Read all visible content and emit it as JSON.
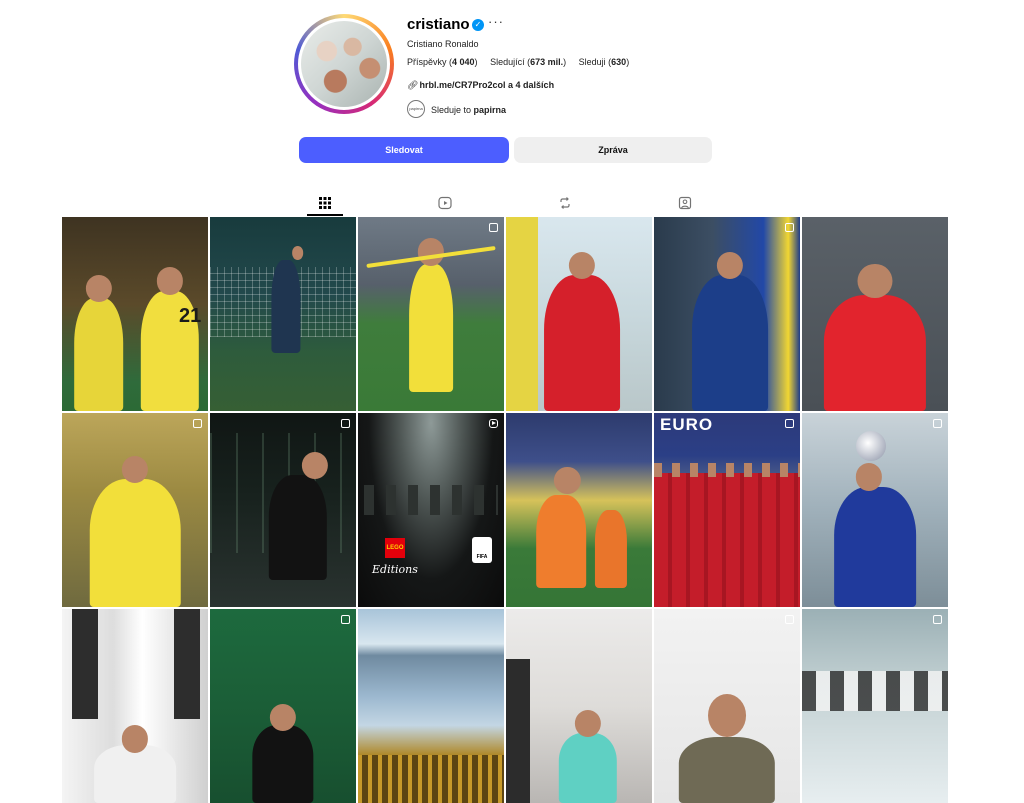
{
  "profile": {
    "username": "cristiano",
    "full_name": "Cristiano Ronaldo",
    "stats": {
      "posts_label": "Příspěvky",
      "posts_value": "4 040",
      "followers_label": "Sledující",
      "followers_value": "673 mil.",
      "following_label": "Sleduji",
      "following_value": "630"
    },
    "link_text": "hrbl.me/CR7Pro2col a 4 dalších",
    "followed_by_prefix": "Sleduje to",
    "followed_by_name": "papirna",
    "followed_by_avatar_text": "papirna"
  },
  "actions": {
    "follow_label": "Sledovat",
    "message_label": "Zpráva"
  },
  "tabs": [
    {
      "name": "posts",
      "icon": "grid-icon",
      "active": true
    },
    {
      "name": "reels",
      "icon": "reels-icon",
      "active": false
    },
    {
      "name": "reposts",
      "icon": "repost-icon",
      "active": false
    },
    {
      "name": "tagged",
      "icon": "tagged-icon",
      "active": false
    }
  ],
  "grid": {
    "lego_text": "LEGO",
    "editions_text": "Editions",
    "fifa_text": "FIFA",
    "euro_text": "EURO",
    "jersey_text": "21"
  },
  "colors": {
    "accent": "#4c5eff",
    "verified": "#0095f6",
    "secondary_button": "#efefef"
  }
}
